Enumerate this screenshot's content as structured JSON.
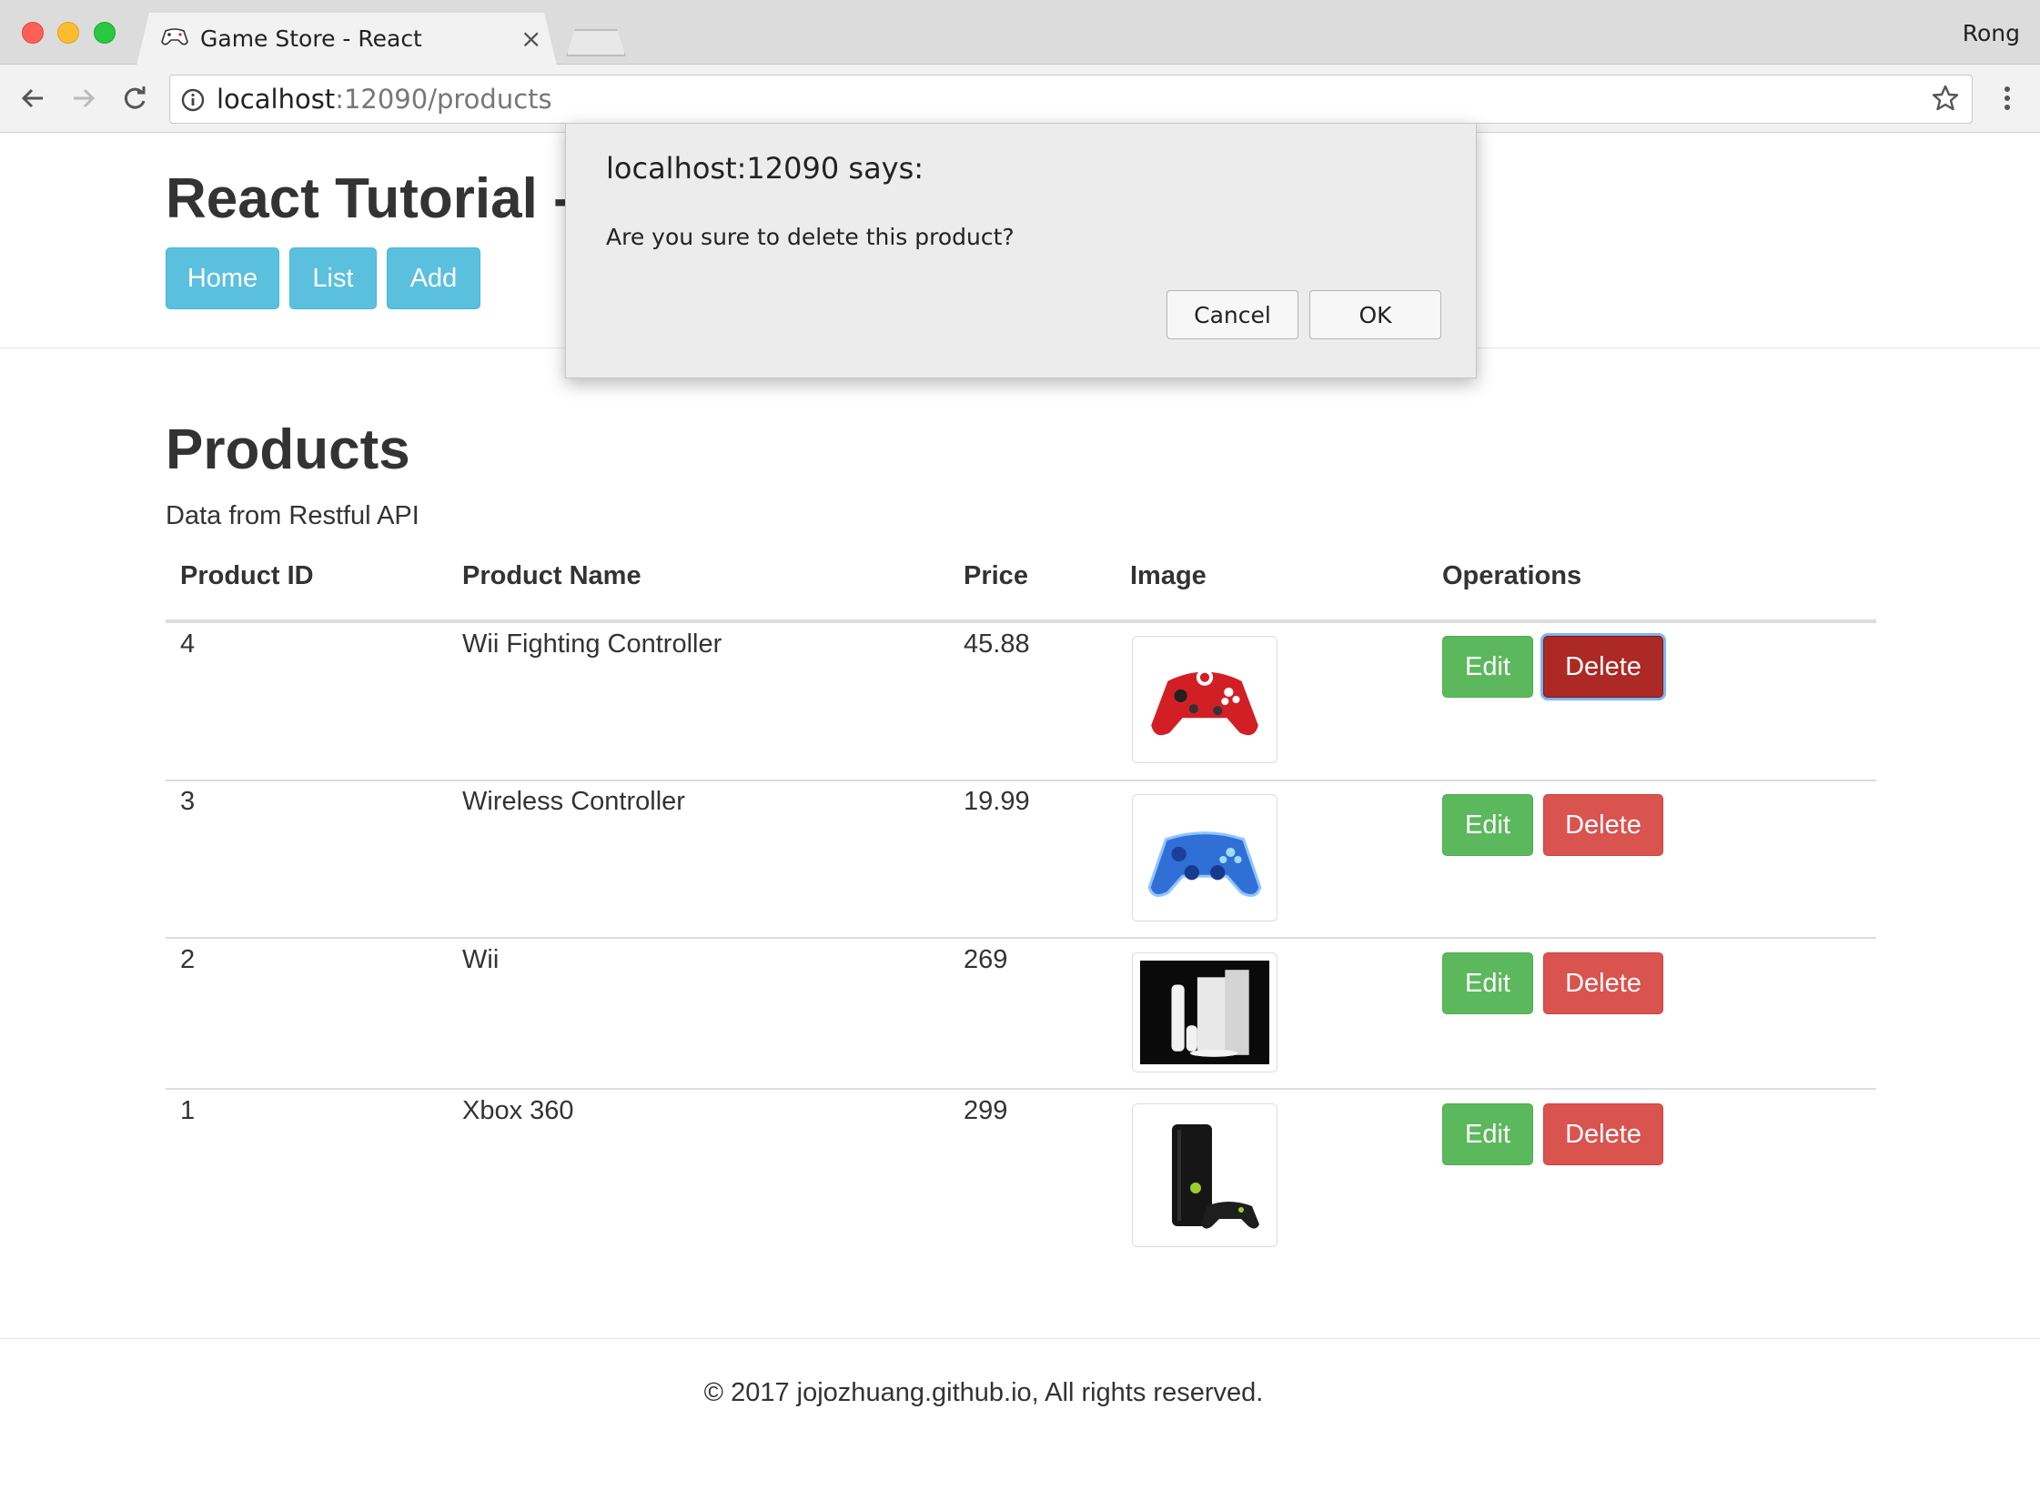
{
  "browser": {
    "tab_title": "Game Store - React",
    "profile_name": "Rong",
    "url_host": "localhost",
    "url_path": ":12090/products"
  },
  "site": {
    "title": "React Tutorial -",
    "nav": [
      "Home",
      "List",
      "Add"
    ]
  },
  "products": {
    "heading": "Products",
    "subtext": "Data from Restful API",
    "columns": [
      "Product ID",
      "Product Name",
      "Price",
      "Image",
      "Operations"
    ],
    "rows": [
      {
        "id": "4",
        "name": "Wii Fighting Controller",
        "price": "45.88",
        "image": "red-gamepad-image"
      },
      {
        "id": "3",
        "name": "Wireless Controller",
        "price": "19.99",
        "image": "blue-gamepad-image"
      },
      {
        "id": "2",
        "name": "Wii",
        "price": "269",
        "image": "wii-console-image"
      },
      {
        "id": "1",
        "name": "Xbox 360",
        "price": "299",
        "image": "xbox-console-image"
      }
    ],
    "edit_label": "Edit",
    "delete_label": "Delete"
  },
  "footer": {
    "text": "© 2017 jojozhuang.github.io, All rights reserved."
  },
  "dialog": {
    "title": "localhost:12090 says:",
    "message": "Are you sure to delete this product?",
    "cancel_label": "Cancel",
    "ok_label": "OK"
  },
  "colors": {
    "info": "#5bc0de",
    "success": "#5cb85c",
    "danger": "#d9534f",
    "danger_active": "#ac2925"
  }
}
